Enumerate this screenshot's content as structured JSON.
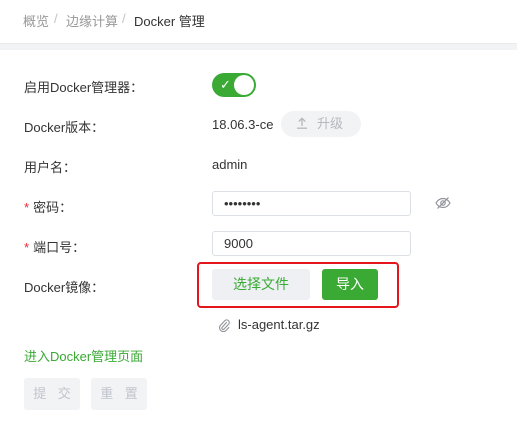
{
  "breadcrumb": {
    "items": [
      "概览",
      "边缘计算",
      "Docker 管理"
    ],
    "separator": "/"
  },
  "form": {
    "enable_label": "启用Docker管理器：",
    "enable_on": true,
    "version_label": "Docker版本：",
    "version_value": "18.06.3-ce",
    "upgrade_label": "升级",
    "username_label": "用户名：",
    "username_value": "admin",
    "required_mark": "*",
    "password_label": "密码：",
    "password_value": "••••••••",
    "port_label": "端口号：",
    "port_value": "9000",
    "image_label": "Docker镜像：",
    "choose_file_label": "选择文件",
    "import_label": "导入",
    "file_name": "ls-agent.tar.gz",
    "enter_link": "进入Docker管理页面",
    "submit_label": "提 交",
    "reset_label": "重 置"
  },
  "icons": {
    "switch_check": "check-icon",
    "upgrade": "upload-icon",
    "password_toggle": "eye-slash-icon",
    "attachment": "paperclip-icon"
  },
  "colors": {
    "accent": "#3aaa35",
    "required": "#f5222d",
    "highlight_box": "#e5161b",
    "disabled_bg": "#f2f3f5",
    "disabled_text": "#c0c4cc"
  }
}
